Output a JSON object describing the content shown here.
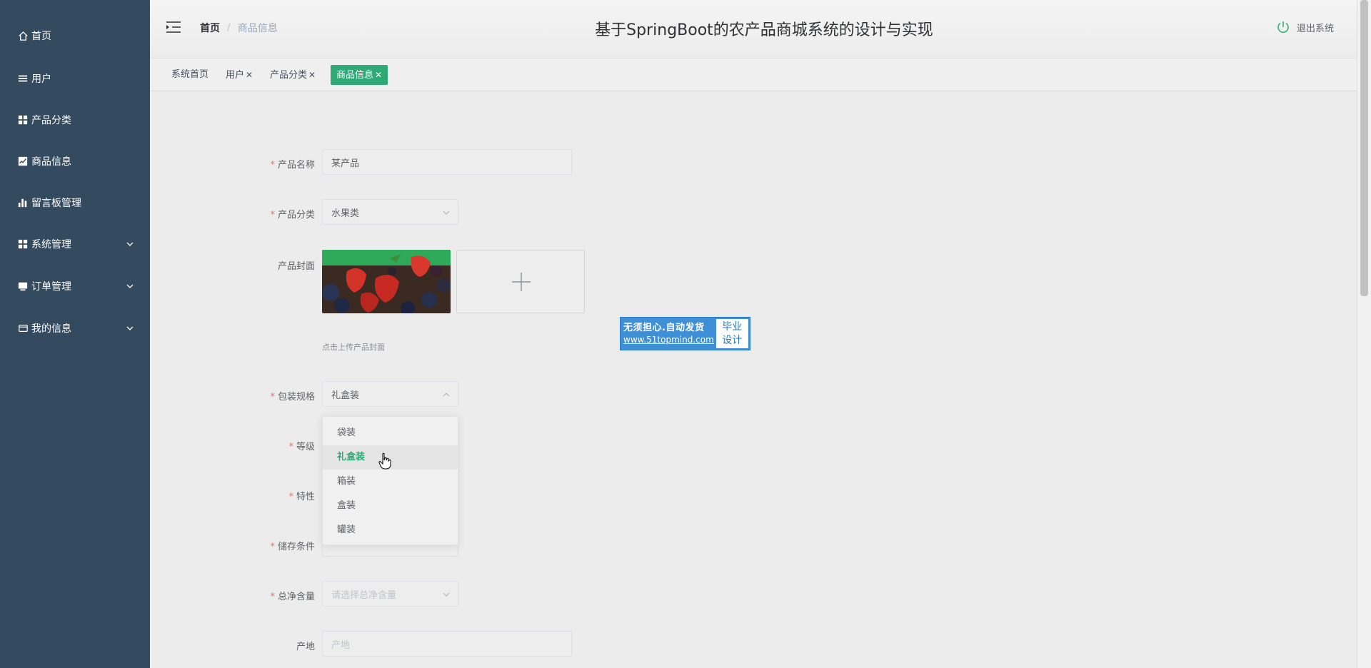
{
  "sidebar": {
    "items": [
      {
        "label": "首页",
        "icon": "home-icon"
      },
      {
        "label": "用户",
        "icon": "list-icon"
      },
      {
        "label": "产品分类",
        "icon": "grid-icon"
      },
      {
        "label": "商品信息",
        "icon": "chart-check-icon"
      },
      {
        "label": "留言板管理",
        "icon": "bar-chart-icon"
      },
      {
        "label": "系统管理",
        "icon": "grid-icon"
      },
      {
        "label": "订单管理",
        "icon": "monitor-icon"
      },
      {
        "label": "我的信息",
        "icon": "card-icon"
      }
    ]
  },
  "header": {
    "breadcrumb_home": "首页",
    "breadcrumb_sep": "/",
    "breadcrumb_current": "商品信息",
    "title": "基于SpringBoot的农产品商城系统的设计与实现",
    "logout_label": "退出系统"
  },
  "tabs": [
    {
      "label": "系统首页",
      "closable": false
    },
    {
      "label": "用户",
      "closable": true
    },
    {
      "label": "产品分类",
      "closable": true
    },
    {
      "label": "商品信息",
      "closable": true,
      "active": true
    }
  ],
  "tab_close_glyph": "✕",
  "form": {
    "name": {
      "label": "产品名称",
      "required": "*",
      "value": "某产品"
    },
    "category": {
      "label": "产品分类",
      "required": "*",
      "value": "水果类"
    },
    "cover": {
      "label": "产品封面",
      "hint": "点击上传产品封面"
    },
    "packing": {
      "label": "包装规格",
      "required": "*",
      "value": "礼盒装"
    },
    "grade": {
      "label": "等级",
      "required": "*"
    },
    "feature": {
      "label": "特性",
      "required": "*"
    },
    "storage": {
      "label": "储存条件",
      "required": "*"
    },
    "net_weight": {
      "label": "总净含量",
      "required": "*",
      "placeholder": "请选择总净含量"
    },
    "origin": {
      "label": "产地",
      "placeholder": "产地"
    }
  },
  "dropdown": {
    "options": [
      "袋装",
      "礼盒装",
      "箱装",
      "盒装",
      "罐装"
    ],
    "selected": "礼盒装"
  },
  "watermark": {
    "line1": "无须担心.自动发货",
    "line2": "www.51topmind.com",
    "right_top": "毕业",
    "right_bottom": "设计"
  },
  "colors": {
    "sidebar_bg": "#344a5f",
    "accent": "#2fa976",
    "required": "#f56c6c"
  }
}
